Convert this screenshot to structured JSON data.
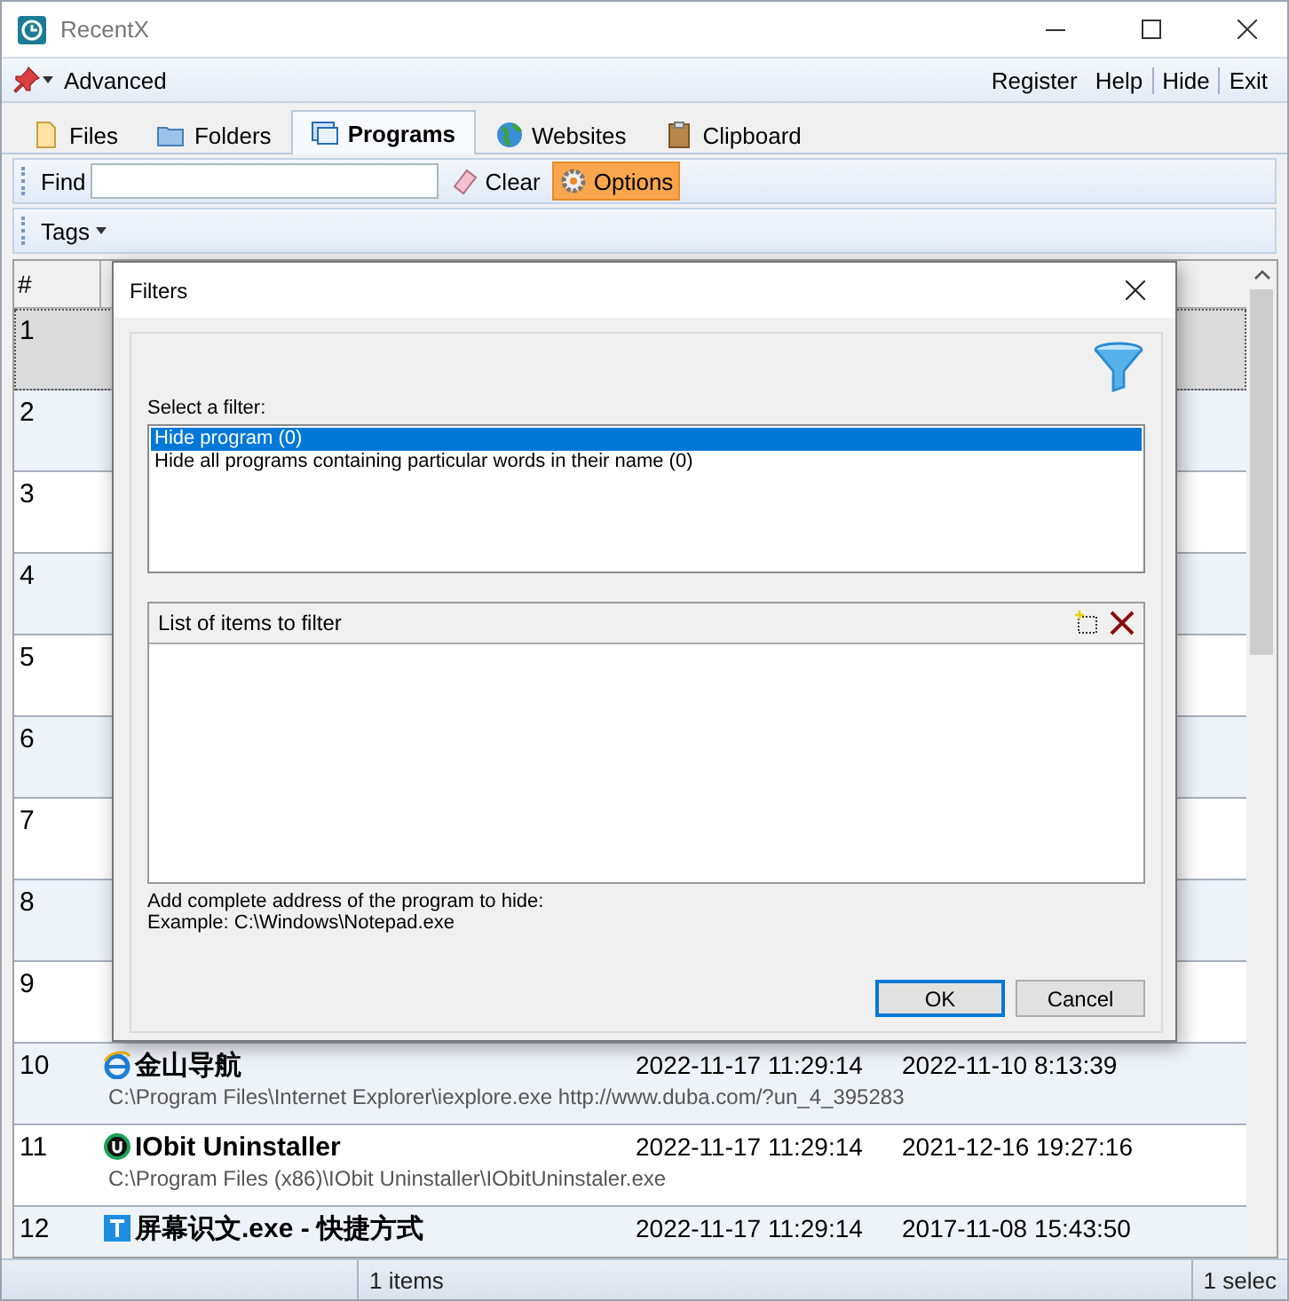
{
  "window": {
    "title": "RecentX"
  },
  "menu": {
    "left": "Advanced",
    "right": [
      "Register",
      "Help",
      "Hide",
      "Exit"
    ]
  },
  "tabs": [
    {
      "label": "Files",
      "kind": "file",
      "selected": false
    },
    {
      "label": "Folders",
      "kind": "folder",
      "selected": false
    },
    {
      "label": "Programs",
      "kind": "program",
      "selected": true
    },
    {
      "label": "Websites",
      "kind": "globe",
      "selected": false
    },
    {
      "label": "Clipboard",
      "kind": "clipboard",
      "selected": false
    }
  ],
  "find_bar": {
    "label": "Find",
    "clear": "Clear",
    "options": {
      "label": "Options",
      "active": true
    }
  },
  "tags_bar": {
    "label": "Tags"
  },
  "table": {
    "columns": [
      "#"
    ],
    "rows": [
      {
        "number": "1",
        "selected": true
      },
      {
        "number": "2",
        "selected": false
      },
      {
        "number": "3",
        "selected": false
      },
      {
        "number": "4",
        "selected": false
      },
      {
        "number": "5",
        "selected": false
      },
      {
        "number": "6",
        "selected": false
      },
      {
        "number": "7",
        "selected": false
      },
      {
        "number": "8",
        "selected": false
      },
      {
        "number": "9",
        "selected": false
      },
      {
        "number": "10",
        "selected": false,
        "kind": "browser",
        "name": "金山导航",
        "date_1": "2022-11-17 11:29:14",
        "date_2": "2022-11-10 8:13:39",
        "path": "C:\\Program Files\\Internet Explorer\\iexplore.exe http://www.duba.com/?un_4_395283"
      },
      {
        "number": "11",
        "selected": false,
        "kind": "uninstaller",
        "name": "IObit Uninstaller",
        "date_1": "2022-11-17 11:29:14",
        "date_2": "2021-12-16 19:27:16",
        "path": "C:\\Program Files (x86)\\IObit Uninstaller\\IObitUninstaler.exe"
      },
      {
        "number": "12",
        "selected": false,
        "kind": "text",
        "name": "屏幕识文.exe - 快捷方式",
        "date_1": "2022-11-17 11:29:14",
        "date_2": "2017-11-08 15:43:50"
      }
    ]
  },
  "dialog": {
    "title": "Filters",
    "select_label": "Select a filter:",
    "filters": [
      {
        "label": "Hide program (0)",
        "selected": true
      },
      {
        "label": "Hide all programs containing particular words in their name (0)",
        "selected": false
      }
    ],
    "items_header": "List of items to filter",
    "hint": [
      "Add complete address of the program to hide:",
      "Example: C:\\Windows\\Notepad.exe"
    ],
    "buttons": [
      {
        "label": "OK",
        "default": true
      },
      {
        "label": "Cancel",
        "default": false
      }
    ]
  },
  "status_bar": [
    "1 items",
    "1 selec"
  ]
}
